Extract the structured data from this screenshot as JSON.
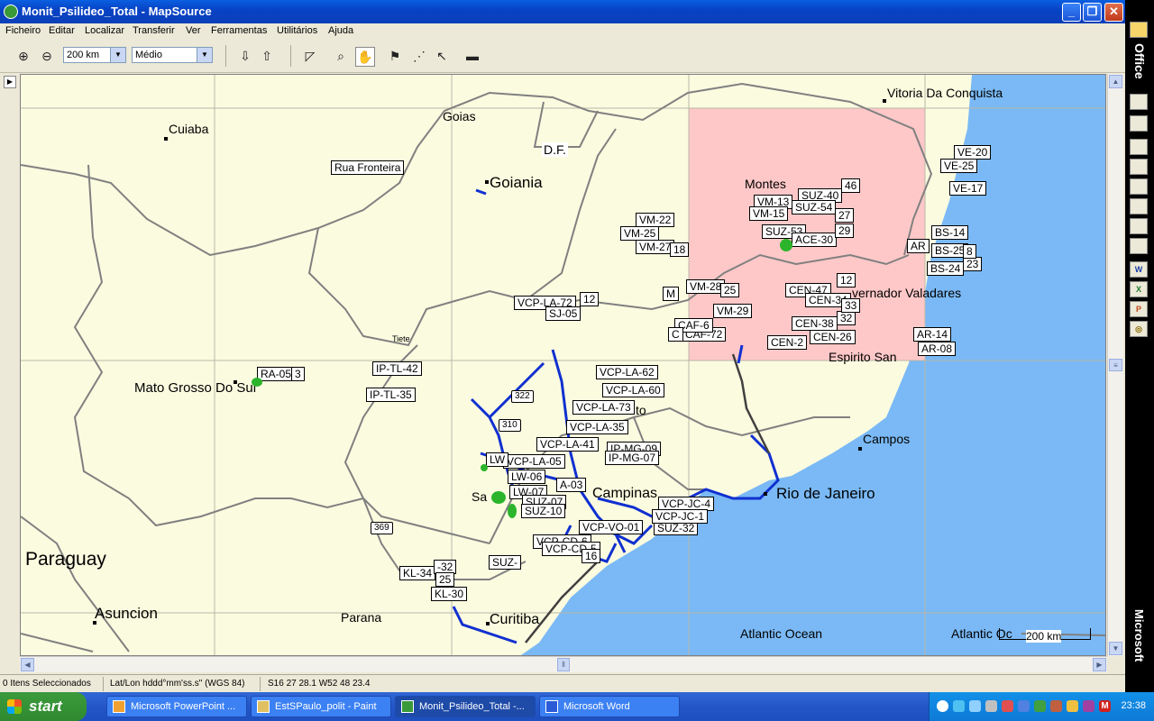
{
  "window": {
    "title": "Monit_Psilideo_Total - MapSource",
    "minimize": "_",
    "maximize": "❐",
    "close": "✕"
  },
  "menu": [
    "Ficheiro",
    "Editar",
    "Localizar",
    "Transferir",
    "Ver",
    "Ferramentas",
    "Utilitários",
    "Ajuda"
  ],
  "toolbar": {
    "zoom_value": "200 km",
    "detail_value": "Médio"
  },
  "map": {
    "cities": {
      "vitoria": "Vitoria Da Conquista",
      "goias": "Goias",
      "cuiaba": "Cuiaba",
      "df": "D.F.",
      "goiania": "Goiania",
      "montes": "Montes",
      "governador": "vernador Valadares",
      "espirito": "Espirito San",
      "tiete": "Tiete",
      "ms": "Mato Grosso Do Sul",
      "campos": "Campos",
      "rio": "Rio de Janeiro",
      "campinas": "Campinas",
      "paraguay": "Paraguay",
      "asuncion": "Asuncion",
      "parana": "Parana",
      "curitiba": "Curitiba",
      "atlantic1": "Atlantic Ocean",
      "atlantic2": "Atlantic Oc",
      "sa": "Sa",
      "to": "to"
    },
    "waypoints": {
      "rua": "Rua Fronteira",
      "vm22": "VM-22",
      "vm25": "VM-25",
      "vm27": "VM-27",
      "v18": "18",
      "vm13": "VM-13",
      "vm15": "VM-15",
      "suz40": "SUZ-40",
      "suz54": "SUZ-54",
      "suz53": "SUZ-53",
      "ace30": "ACE-30",
      "n27": "27",
      "n29": "29",
      "n46": "46",
      "ve20": "VE-20",
      "ve25": "VE-25",
      "ve17": "VE-17",
      "bs14": "BS-14",
      "bs25": "BS-25",
      "bs24": "BS-24",
      "n23": "23",
      "n8": "8",
      "ar": "AR",
      "ar14": "AR-14",
      "ar08": "AR-08",
      "vm28": "VM-28",
      "vm29": "VM-29",
      "n25": "25",
      "caf72": "CAF-72",
      "caf6": "CAF-6",
      "c": "C",
      "m": "M",
      "cen47": "CEN-47",
      "cen34": "CEN-34",
      "cen38": "CEN-38",
      "cen2": "CEN-2",
      "cen26": "CEN-26",
      "n12": "12",
      "n32": "32",
      "n33": "33",
      "vcpla72": "VCP-LA-72",
      "n12b": "12",
      "sj05": "SJ-05",
      "ra05": "RA-05",
      "n3": "3",
      "iptl42": "IP-TL-42",
      "iptl35": "IP-TL-35",
      "vcpla62": "VCP-LA-62",
      "vcpla60": "VCP-LA-60",
      "vcpla73": "VCP-LA-73",
      "vcpla35": "VCP-LA-35",
      "vcpla41": "VCP-LA-41",
      "vcpla05": "VCP-LA-05",
      "ipmg09": "IP-MG-09",
      "ipmg07": "IP-MG-07",
      "lw": "LW",
      "lw06": "LW-06",
      "lw07": "LW-07",
      "a03": "A-03",
      "suz07": "SUZ-07",
      "suz10": "SUZ-10",
      "suz32": "SUZ-32",
      "suz": "SUZ-",
      "vcpjc4": "VCP-JC-4",
      "vcpjc1": "VCP-JC-1",
      "vcpvo01": "VCP-VO-01",
      "vcpcd6": "VCP-CD-6",
      "vcpcd5": "VCP-CD-5",
      "n16": "16",
      "kl34": "KL-34",
      "kl30": "KL-30",
      "n32b": "-32",
      "n25b": "25"
    },
    "shields": {
      "r322": "322",
      "r310": "310",
      "r369": "369"
    },
    "scale": "200 km"
  },
  "status": {
    "selected": "0 Itens Seleccionados",
    "format": "Lat/Lon hddd°mm'ss.s\" (WGS 84)",
    "coords": "S16 27 28.1 W52 48 23.4"
  },
  "office": {
    "label": "Office",
    "brand": "Microsoft"
  },
  "taskbar": {
    "start": "start",
    "tasks": [
      "Microsoft PowerPoint ...",
      "EstSPaulo_polit - Paint",
      "Monit_Psilideo_Total -...",
      "Microsoft Word"
    ],
    "clock": "23:38"
  }
}
